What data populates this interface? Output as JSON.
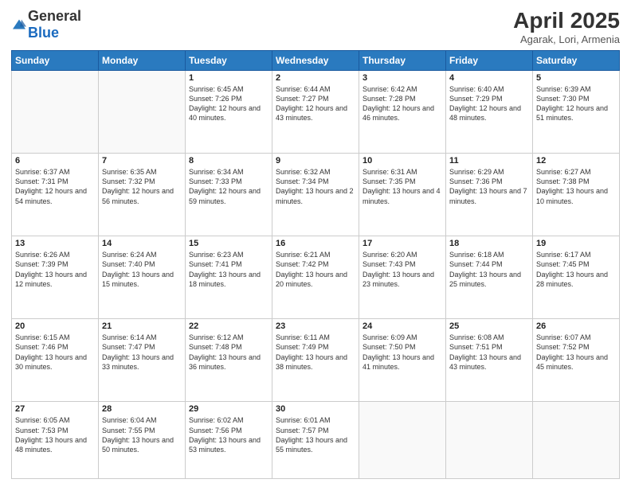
{
  "header": {
    "logo_general": "General",
    "logo_blue": "Blue",
    "month": "April 2025",
    "location": "Agarak, Lori, Armenia"
  },
  "weekdays": [
    "Sunday",
    "Monday",
    "Tuesday",
    "Wednesday",
    "Thursday",
    "Friday",
    "Saturday"
  ],
  "weeks": [
    [
      {
        "num": "",
        "info": ""
      },
      {
        "num": "",
        "info": ""
      },
      {
        "num": "1",
        "info": "Sunrise: 6:45 AM\nSunset: 7:26 PM\nDaylight: 12 hours and 40 minutes."
      },
      {
        "num": "2",
        "info": "Sunrise: 6:44 AM\nSunset: 7:27 PM\nDaylight: 12 hours and 43 minutes."
      },
      {
        "num": "3",
        "info": "Sunrise: 6:42 AM\nSunset: 7:28 PM\nDaylight: 12 hours and 46 minutes."
      },
      {
        "num": "4",
        "info": "Sunrise: 6:40 AM\nSunset: 7:29 PM\nDaylight: 12 hours and 48 minutes."
      },
      {
        "num": "5",
        "info": "Sunrise: 6:39 AM\nSunset: 7:30 PM\nDaylight: 12 hours and 51 minutes."
      }
    ],
    [
      {
        "num": "6",
        "info": "Sunrise: 6:37 AM\nSunset: 7:31 PM\nDaylight: 12 hours and 54 minutes."
      },
      {
        "num": "7",
        "info": "Sunrise: 6:35 AM\nSunset: 7:32 PM\nDaylight: 12 hours and 56 minutes."
      },
      {
        "num": "8",
        "info": "Sunrise: 6:34 AM\nSunset: 7:33 PM\nDaylight: 12 hours and 59 minutes."
      },
      {
        "num": "9",
        "info": "Sunrise: 6:32 AM\nSunset: 7:34 PM\nDaylight: 13 hours and 2 minutes."
      },
      {
        "num": "10",
        "info": "Sunrise: 6:31 AM\nSunset: 7:35 PM\nDaylight: 13 hours and 4 minutes."
      },
      {
        "num": "11",
        "info": "Sunrise: 6:29 AM\nSunset: 7:36 PM\nDaylight: 13 hours and 7 minutes."
      },
      {
        "num": "12",
        "info": "Sunrise: 6:27 AM\nSunset: 7:38 PM\nDaylight: 13 hours and 10 minutes."
      }
    ],
    [
      {
        "num": "13",
        "info": "Sunrise: 6:26 AM\nSunset: 7:39 PM\nDaylight: 13 hours and 12 minutes."
      },
      {
        "num": "14",
        "info": "Sunrise: 6:24 AM\nSunset: 7:40 PM\nDaylight: 13 hours and 15 minutes."
      },
      {
        "num": "15",
        "info": "Sunrise: 6:23 AM\nSunset: 7:41 PM\nDaylight: 13 hours and 18 minutes."
      },
      {
        "num": "16",
        "info": "Sunrise: 6:21 AM\nSunset: 7:42 PM\nDaylight: 13 hours and 20 minutes."
      },
      {
        "num": "17",
        "info": "Sunrise: 6:20 AM\nSunset: 7:43 PM\nDaylight: 13 hours and 23 minutes."
      },
      {
        "num": "18",
        "info": "Sunrise: 6:18 AM\nSunset: 7:44 PM\nDaylight: 13 hours and 25 minutes."
      },
      {
        "num": "19",
        "info": "Sunrise: 6:17 AM\nSunset: 7:45 PM\nDaylight: 13 hours and 28 minutes."
      }
    ],
    [
      {
        "num": "20",
        "info": "Sunrise: 6:15 AM\nSunset: 7:46 PM\nDaylight: 13 hours and 30 minutes."
      },
      {
        "num": "21",
        "info": "Sunrise: 6:14 AM\nSunset: 7:47 PM\nDaylight: 13 hours and 33 minutes."
      },
      {
        "num": "22",
        "info": "Sunrise: 6:12 AM\nSunset: 7:48 PM\nDaylight: 13 hours and 36 minutes."
      },
      {
        "num": "23",
        "info": "Sunrise: 6:11 AM\nSunset: 7:49 PM\nDaylight: 13 hours and 38 minutes."
      },
      {
        "num": "24",
        "info": "Sunrise: 6:09 AM\nSunset: 7:50 PM\nDaylight: 13 hours and 41 minutes."
      },
      {
        "num": "25",
        "info": "Sunrise: 6:08 AM\nSunset: 7:51 PM\nDaylight: 13 hours and 43 minutes."
      },
      {
        "num": "26",
        "info": "Sunrise: 6:07 AM\nSunset: 7:52 PM\nDaylight: 13 hours and 45 minutes."
      }
    ],
    [
      {
        "num": "27",
        "info": "Sunrise: 6:05 AM\nSunset: 7:53 PM\nDaylight: 13 hours and 48 minutes."
      },
      {
        "num": "28",
        "info": "Sunrise: 6:04 AM\nSunset: 7:55 PM\nDaylight: 13 hours and 50 minutes."
      },
      {
        "num": "29",
        "info": "Sunrise: 6:02 AM\nSunset: 7:56 PM\nDaylight: 13 hours and 53 minutes."
      },
      {
        "num": "30",
        "info": "Sunrise: 6:01 AM\nSunset: 7:57 PM\nDaylight: 13 hours and 55 minutes."
      },
      {
        "num": "",
        "info": ""
      },
      {
        "num": "",
        "info": ""
      },
      {
        "num": "",
        "info": ""
      }
    ]
  ]
}
